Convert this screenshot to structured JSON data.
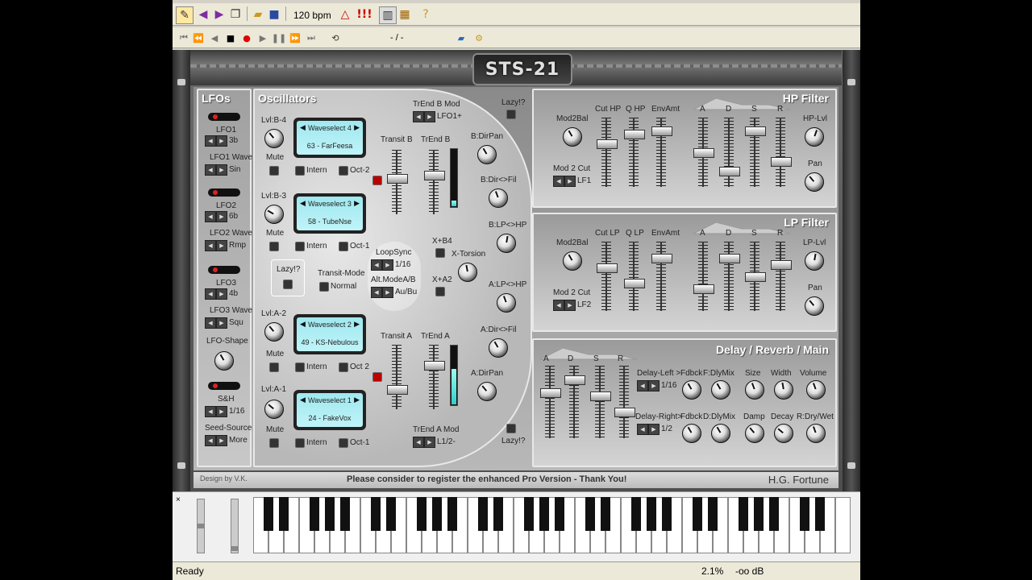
{
  "toolbar": {
    "bpm": "120 bpm",
    "position": "- / -"
  },
  "synth": {
    "logo": "STS-21",
    "lfos": {
      "title": "LFOs",
      "items": [
        {
          "label": "LFO1",
          "value": "3b",
          "wave_label": "LFO1 Wave",
          "wave": "Sin"
        },
        {
          "label": "LFO2",
          "value": "6b",
          "wave_label": "LFO2 Wave",
          "wave": "Rmp"
        },
        {
          "label": "LFO3",
          "value": "4b",
          "wave_label": "LFO3 Wave",
          "wave": "Squ"
        }
      ],
      "shape_label": "LFO-Shape",
      "sh_label": "S&H",
      "sh_value": "1/16",
      "seed_label": "Seed-Source",
      "seed_value": "More"
    },
    "oscillators": {
      "title": "Oscillators",
      "slots": [
        {
          "lvl": "Lvl:B-4",
          "wave": "Waveselect 4",
          "patch": "63 - FarFeesa",
          "oct": "Oct-2"
        },
        {
          "lvl": "Lvl:B-3",
          "wave": "Waveselect 3",
          "patch": "58 - TubeNse",
          "oct": "Oct-1"
        },
        {
          "lvl": "Lvl:A-2",
          "wave": "Waveselect 2",
          "patch": "49 - KS-Nebulous",
          "oct": "Oct 2"
        },
        {
          "lvl": "Lvl:A-1",
          "wave": "Waveselect 1",
          "patch": "24 - FakeVox",
          "oct": "Oct-1"
        }
      ],
      "mute": "Mute",
      "intern": "Intern",
      "lazy": "Lazy!?",
      "transit_mode": "Transit-Mode",
      "transit_value": "Normal",
      "loopsync": "LoopSync",
      "loopsync_value": "1/16",
      "altmode": "Alt.ModeA/B",
      "altmode_value": "Au/Bu",
      "transit_b": "Transit B",
      "trend_b": "TrEnd B",
      "transit_a": "Transit A",
      "trend_a": "TrEnd A",
      "trend_b_mod": "TrEnd B Mod",
      "trend_b_mod_value": "LFO1+",
      "trend_a_mod": "TrEnd A Mod",
      "trend_a_mod_value": "L1/2-",
      "bdirpan": "B:DirPan",
      "bdirfil": "B:Dir<>Fil",
      "blphp": "B:LP<>HP",
      "xb4": "X+B4",
      "xtorsion": "X-Torsion",
      "xa2": "X+A2",
      "alphp": "A:LP<>HP",
      "adirfil": "A:Dir<>Fil",
      "adirpan": "A:DirPan",
      "lazy_top": "Lazy!?",
      "lazy_bottom": "Lazy!?"
    },
    "hp": {
      "title": "HP Filter",
      "mod2bal": "Mod2Bal",
      "mod2cut": "Mod 2 Cut",
      "mod2cut_value": "LF1",
      "cut": "Cut HP",
      "q": "Q HP",
      "env": "EnvAmt",
      "a": "A",
      "d": "D",
      "s": "S",
      "r": "R",
      "lvl": "HP-Lvl",
      "pan": "Pan",
      "fader_levels": [
        0.35,
        0.2,
        0.15,
        0.5,
        0.8,
        0.15,
        0.65
      ]
    },
    "lp": {
      "title": "LP Filter",
      "mod2bal": "Mod2Bal",
      "mod2cut": "Mod 2 Cut",
      "mod2cut_value": "LF2",
      "cut": "Cut LP",
      "q": "Q LP",
      "env": "EnvAmt",
      "a": "A",
      "d": "D",
      "s": "S",
      "r": "R",
      "lvl": "LP-Lvl",
      "pan": "Pan",
      "fader_levels": [
        0.35,
        0.6,
        0.2,
        0.7,
        0.2,
        0.5,
        0.3
      ]
    },
    "delay": {
      "title": "Delay / Reverb / Main",
      "a": "A",
      "d": "D",
      "s": "S",
      "r": "R",
      "fader_levels": [
        0.35,
        0.15,
        0.4,
        0.65
      ],
      "left": "Delay-Left >",
      "left_value": "1/16",
      "right": "Delay-Right>",
      "right_value": "1/2",
      "fdbck": "Fdbck",
      "fdlymix": "F:DlyMix",
      "size": "Size",
      "width": "Width",
      "volume": "Volume",
      "fdbck2": "Fdbck",
      "ddlymix": "D:DlyMix",
      "damp": "Damp",
      "decay": "Decay",
      "drywet": "R:Dry/Wet"
    },
    "footer": {
      "design": "Design by V.K.",
      "notice": "Please consider to register the enhanced Pro Version - Thank You!",
      "brand": "H.G. Fortune"
    }
  },
  "status": {
    "text": "Ready",
    "percent": "2.1%",
    "db": "-oo dB"
  }
}
